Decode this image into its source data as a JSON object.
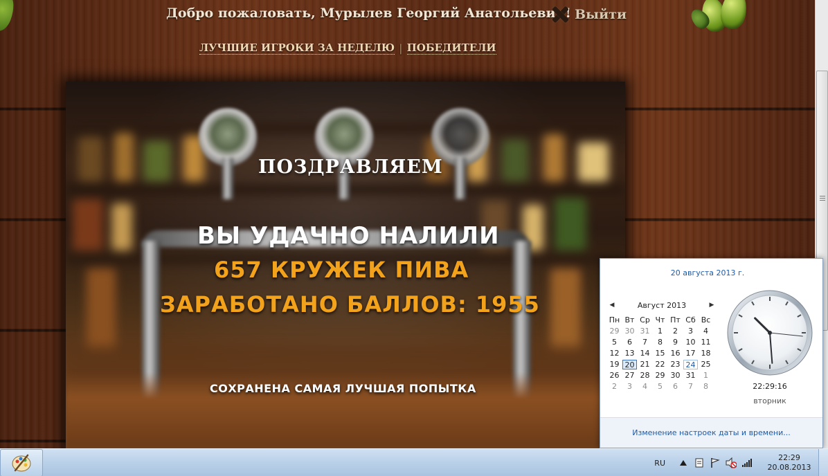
{
  "header": {
    "greeting": "Добро пожаловать, Мурылев Георгий Анатольевич!",
    "logout_label": "Выйти"
  },
  "nav": {
    "best_players": "ЛУЧШИЕ ИГРОКИ ЗА НЕДЕЛЮ",
    "separator": "|",
    "winners": "ПОБЕДИТЕЛИ"
  },
  "result": {
    "congrats": "ПОЗДРАВЛЯЕМ",
    "poured": "ВЫ УДАЧНО НАЛИЛИ",
    "mugs": "657 КРУЖЕК ПИВА",
    "score": "ЗАРАБОТАНО БАЛЛОВ: 1955",
    "saved": "СОХРАНЕНА САМАЯ ЛУЧШАЯ ПОПЫТКА"
  },
  "calendar": {
    "full_date": "20 августа 2013 г.",
    "month_title": "Август 2013",
    "prev_icon": "left-arrow",
    "next_icon": "right-arrow",
    "weekdays": [
      "Пн",
      "Вт",
      "Ср",
      "Чт",
      "Пт",
      "Сб",
      "Вс"
    ],
    "weeks": [
      [
        "29",
        "30",
        "31",
        "1",
        "2",
        "3",
        "4"
      ],
      [
        "5",
        "6",
        "7",
        "8",
        "9",
        "10",
        "11"
      ],
      [
        "12",
        "13",
        "14",
        "15",
        "16",
        "17",
        "18"
      ],
      [
        "19",
        "20",
        "21",
        "22",
        "23",
        "24",
        "25"
      ],
      [
        "26",
        "27",
        "28",
        "29",
        "30",
        "31",
        "1"
      ],
      [
        "2",
        "3",
        "4",
        "5",
        "6",
        "7",
        "8"
      ]
    ],
    "time": "22:29:16",
    "weekday": "вторник",
    "settings_link": "Изменение настроек даты и времени..."
  },
  "taskbar": {
    "language": "RU",
    "time": "22:29",
    "date": "20.08.2013",
    "tray_icons": [
      "show-hidden-icons",
      "action-center-icon",
      "flag-icon",
      "volume-muted-icon",
      "network-signal-icon"
    ]
  },
  "colors": {
    "accent_orange": "#f3a21b",
    "link_blue": "#1f5aa6",
    "today_border": "#3b72c4"
  }
}
